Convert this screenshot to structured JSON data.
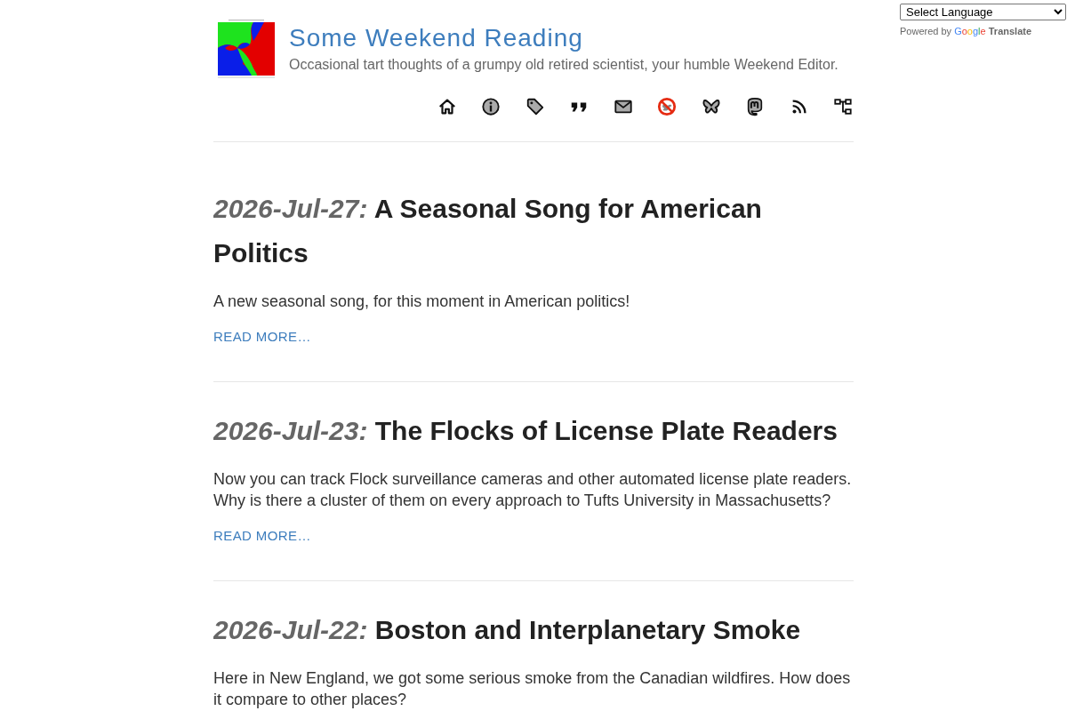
{
  "translate": {
    "select": "Select Language",
    "powered_by": "Powered by",
    "brand": "Google",
    "product": "Translate"
  },
  "header": {
    "title": "Some Weekend Reading",
    "tagline": "Occasional tart thoughts of a grumpy old retired scientist, your humble Weekend Editor."
  },
  "posts": [
    {
      "date": "2026-Jul-27:",
      "title": "A Seasonal Song for American Politics",
      "summary": "A new seasonal song, for this moment in American politics!",
      "link": "READ MORE…"
    },
    {
      "date": "2026-Jul-23:",
      "title": "The Flocks of License Plate Readers",
      "summary": "Now you can track Flock surveillance cameras and other automated license plate readers. Why is there a cluster of them on every approach to Tufts University in Massachusetts?",
      "link": "READ MORE…"
    },
    {
      "date": "2026-Jul-22:",
      "title": "Boston and Interplanetary Smoke",
      "summary": "Here in New England, we got some serious smoke from the Canadian wildfires. How does it compare to other places?"
    }
  ]
}
